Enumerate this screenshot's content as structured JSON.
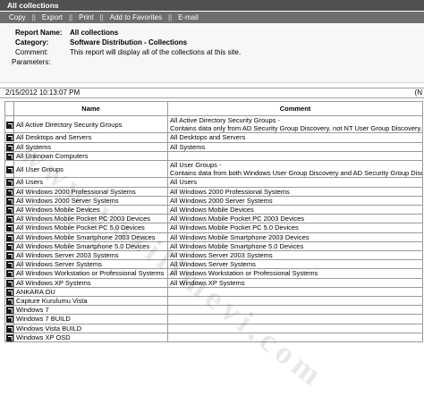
{
  "window": {
    "title": "All collections"
  },
  "toolbar": {
    "items": [
      "Copy",
      "Export",
      "Print",
      "Add to Favorites",
      "E-mail"
    ]
  },
  "info": {
    "report_name_label": "Report Name:",
    "report_name": "All collections",
    "category_label": "Category:",
    "category": "Software Distribution - Collections",
    "comment_label": "Comment:",
    "comment": "This report will display all of the collections at this site.",
    "parameters_label": "Parameters:"
  },
  "run": {
    "date": "2/15/2012 10:13:07 PM",
    "right_text": "(N"
  },
  "table": {
    "headers": {
      "name": "Name",
      "comment": "Comment"
    },
    "rows": [
      {
        "name": "All Active Directory Security Groups",
        "comment": [
          "All Active Directory Security Groups -",
          "Contains data only from AD Security Group Discovery, not NT User Group Discovery."
        ]
      },
      {
        "name": "All Desktops and Servers",
        "comment": [
          "All Desktops and Servers"
        ]
      },
      {
        "name": "All Systems",
        "comment": [
          "All Systems"
        ]
      },
      {
        "name": "All Unknown Computers",
        "comment": [
          ""
        ]
      },
      {
        "name": "All User Groups",
        "comment": [
          "All User Groups -",
          "Contains data from both Windows User Group Discovery and AD Security Group Discovery"
        ]
      },
      {
        "name": "All Users",
        "comment": [
          "All Users"
        ]
      },
      {
        "name": "All Windows 2000 Professional Systems",
        "comment": [
          "All Windows 2000 Professional Systems"
        ]
      },
      {
        "name": "All Windows 2000 Server Systems",
        "comment": [
          "All Windows 2000 Server Systems"
        ]
      },
      {
        "name": "All Windows Mobile Devices",
        "comment": [
          "All Windows Mobile Devices"
        ]
      },
      {
        "name": "All Windows Mobile Pocket PC 2003 Devices",
        "comment": [
          "All Windows Mobile Pocket PC 2003 Devices"
        ]
      },
      {
        "name": "All Windows Mobile Pocket PC 5.0 Devices",
        "comment": [
          "All Windows Mobile Pocket PC 5.0 Devices"
        ]
      },
      {
        "name": "All Windows Mobile Smartphone 2003 Devices",
        "comment": [
          "All Windows Mobile Smartphone 2003 Devices"
        ]
      },
      {
        "name": "All Windows Mobile Smartphone 5.0 Devices",
        "comment": [
          "All Windows Mobile Smartphone 5.0 Devices"
        ]
      },
      {
        "name": "All Windows Server 2003 Systems",
        "comment": [
          "All Windows Server 2003 Systems"
        ]
      },
      {
        "name": "All Windows Server Systems",
        "comment": [
          "All Windows Server Systems"
        ]
      },
      {
        "name": "All Windows Workstation or Professional Systems",
        "comment": [
          "All Windows Workstation or Professional Systems"
        ]
      },
      {
        "name": "All Windows XP Systems",
        "comment": [
          "All Windows XP Systems"
        ]
      },
      {
        "name": "ANKARA OU",
        "comment": [
          ""
        ]
      },
      {
        "name": "Capture Kurulumu Vista",
        "comment": [
          ""
        ]
      },
      {
        "name": "Windows 7",
        "comment": [
          ""
        ]
      },
      {
        "name": "Windows 7 BUILD",
        "comment": [
          ""
        ]
      },
      {
        "name": "Windows Vista BUILD",
        "comment": [
          ""
        ]
      },
      {
        "name": "Windows XP OSD",
        "comment": [
          ""
        ]
      }
    ]
  },
  "watermark": "www.yazilimevi.com"
}
